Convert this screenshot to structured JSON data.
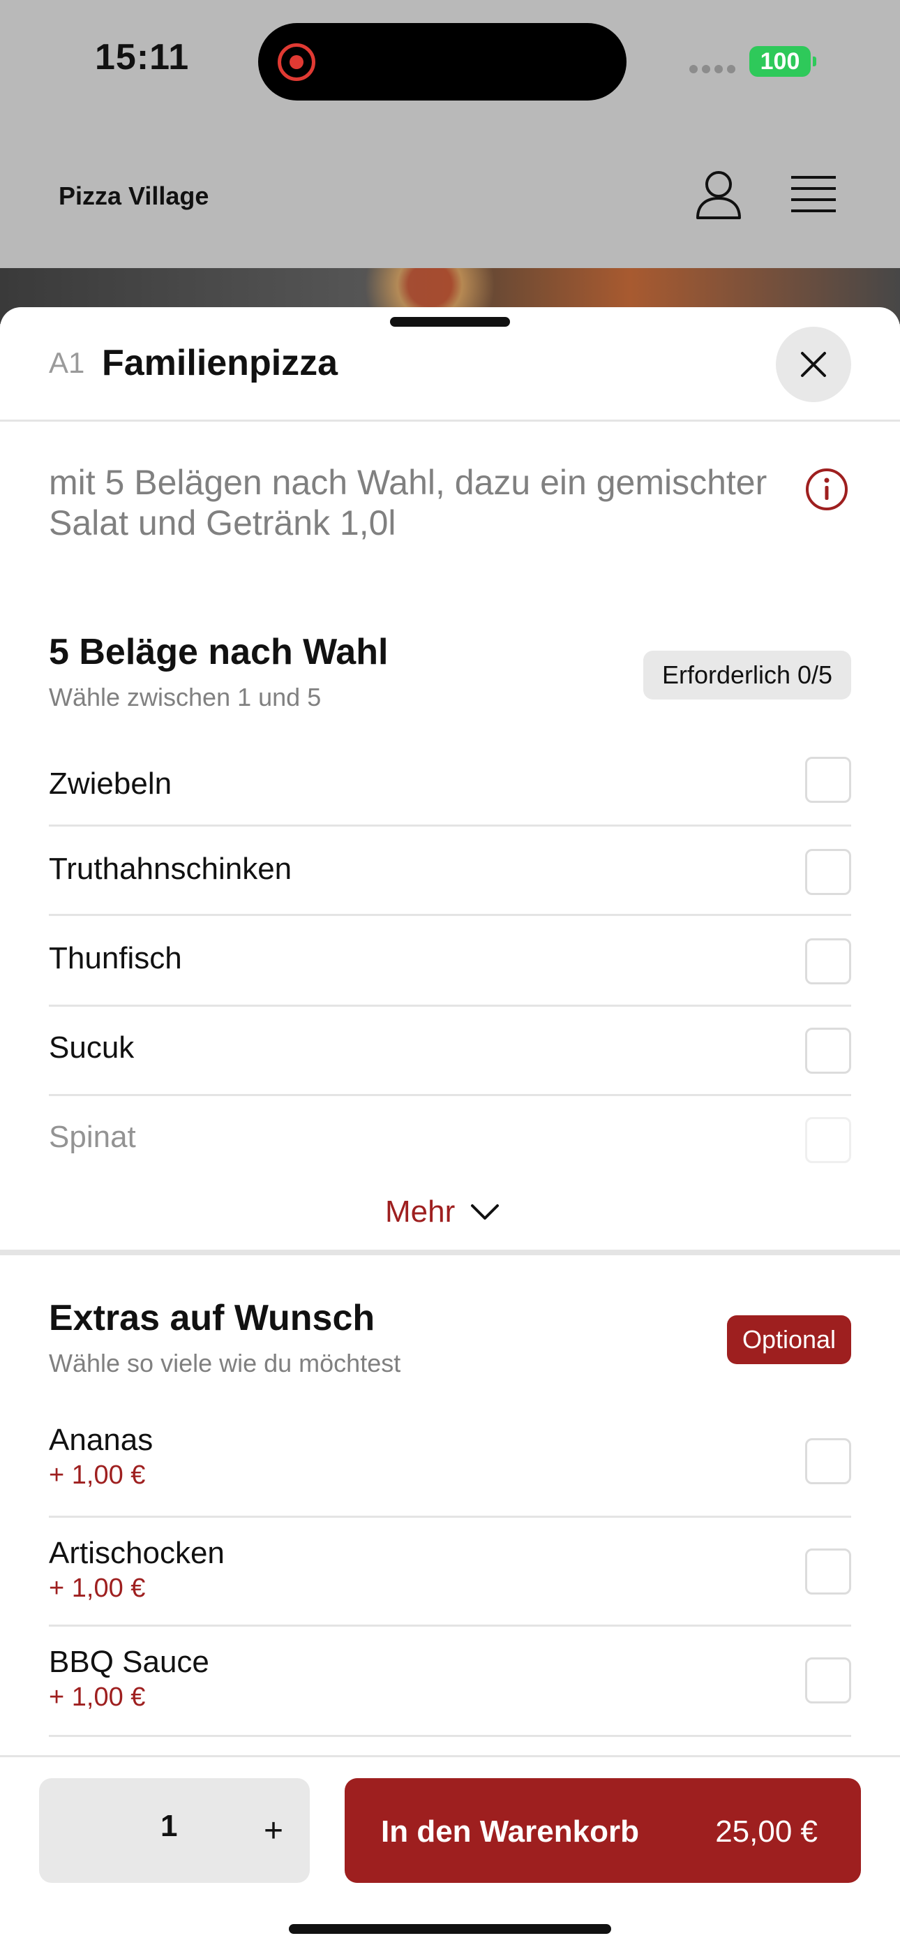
{
  "status_bar": {
    "time": "15:11",
    "battery": "100"
  },
  "header": {
    "brand": "Pizza Village"
  },
  "item": {
    "code": "A1",
    "title": "Familienpizza",
    "description": "mit 5 Belägen nach Wahl, dazu ein gemischter Salat und Getränk 1,0l"
  },
  "toppings": {
    "title": "5 Beläge nach Wahl",
    "subtitle": "Wähle zwischen 1 und 5",
    "badge": "Erforderlich 0/5",
    "options": [
      "Zwiebeln",
      "Truthahnschinken",
      "Thunfisch",
      "Sucuk",
      "Spinat"
    ],
    "more_label": "Mehr"
  },
  "extras": {
    "title": "Extras auf Wunsch",
    "subtitle": "Wähle so viele wie du möchtest",
    "badge": "Optional",
    "options": [
      {
        "label": "Ananas",
        "price": "+ 1,00 €"
      },
      {
        "label": "Artischocken",
        "price": "+ 1,00 €"
      },
      {
        "label": "BBQ Sauce",
        "price": "+ 1,00 €"
      }
    ]
  },
  "cart": {
    "quantity": "1",
    "plus": "+",
    "add_label": "In den Warenkorb",
    "total": "25,00 €"
  },
  "colors": {
    "accent": "#9e1f1f",
    "battery": "#2ec95a",
    "overlay": "#b9b9b9"
  }
}
